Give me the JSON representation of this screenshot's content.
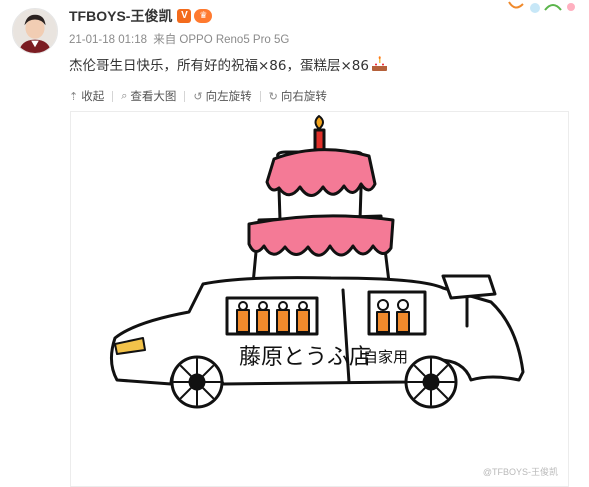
{
  "post": {
    "author": "TFBOYS-王俊凯",
    "verified_badge": "V",
    "timestamp": "21-01-18 01:18",
    "source": "来自 OPPO Reno5 Pro 5G",
    "text": "杰伦哥生日快乐，所有好的祝福×86，蛋糕层×86",
    "cake_emoji": "cake-icon"
  },
  "toolbar": {
    "items": [
      {
        "label": "收起",
        "icon": "collapse-icon"
      },
      {
        "label": "查看大图",
        "icon": "search-icon"
      },
      {
        "label": "向左旋转",
        "icon": "rotate-left-icon"
      },
      {
        "label": "向右旋转",
        "icon": "rotate-right-icon"
      }
    ]
  },
  "image": {
    "drawing_text_left": "藤原とうふ店",
    "drawing_text_right": "自家用",
    "watermark": "@TFBOYS-王俊凯"
  },
  "colors": {
    "frosting": "#f47a96",
    "candle_window": "#f08a2c",
    "badge_orange": "#f36b1c",
    "meta_gray": "#8a8a8a"
  }
}
